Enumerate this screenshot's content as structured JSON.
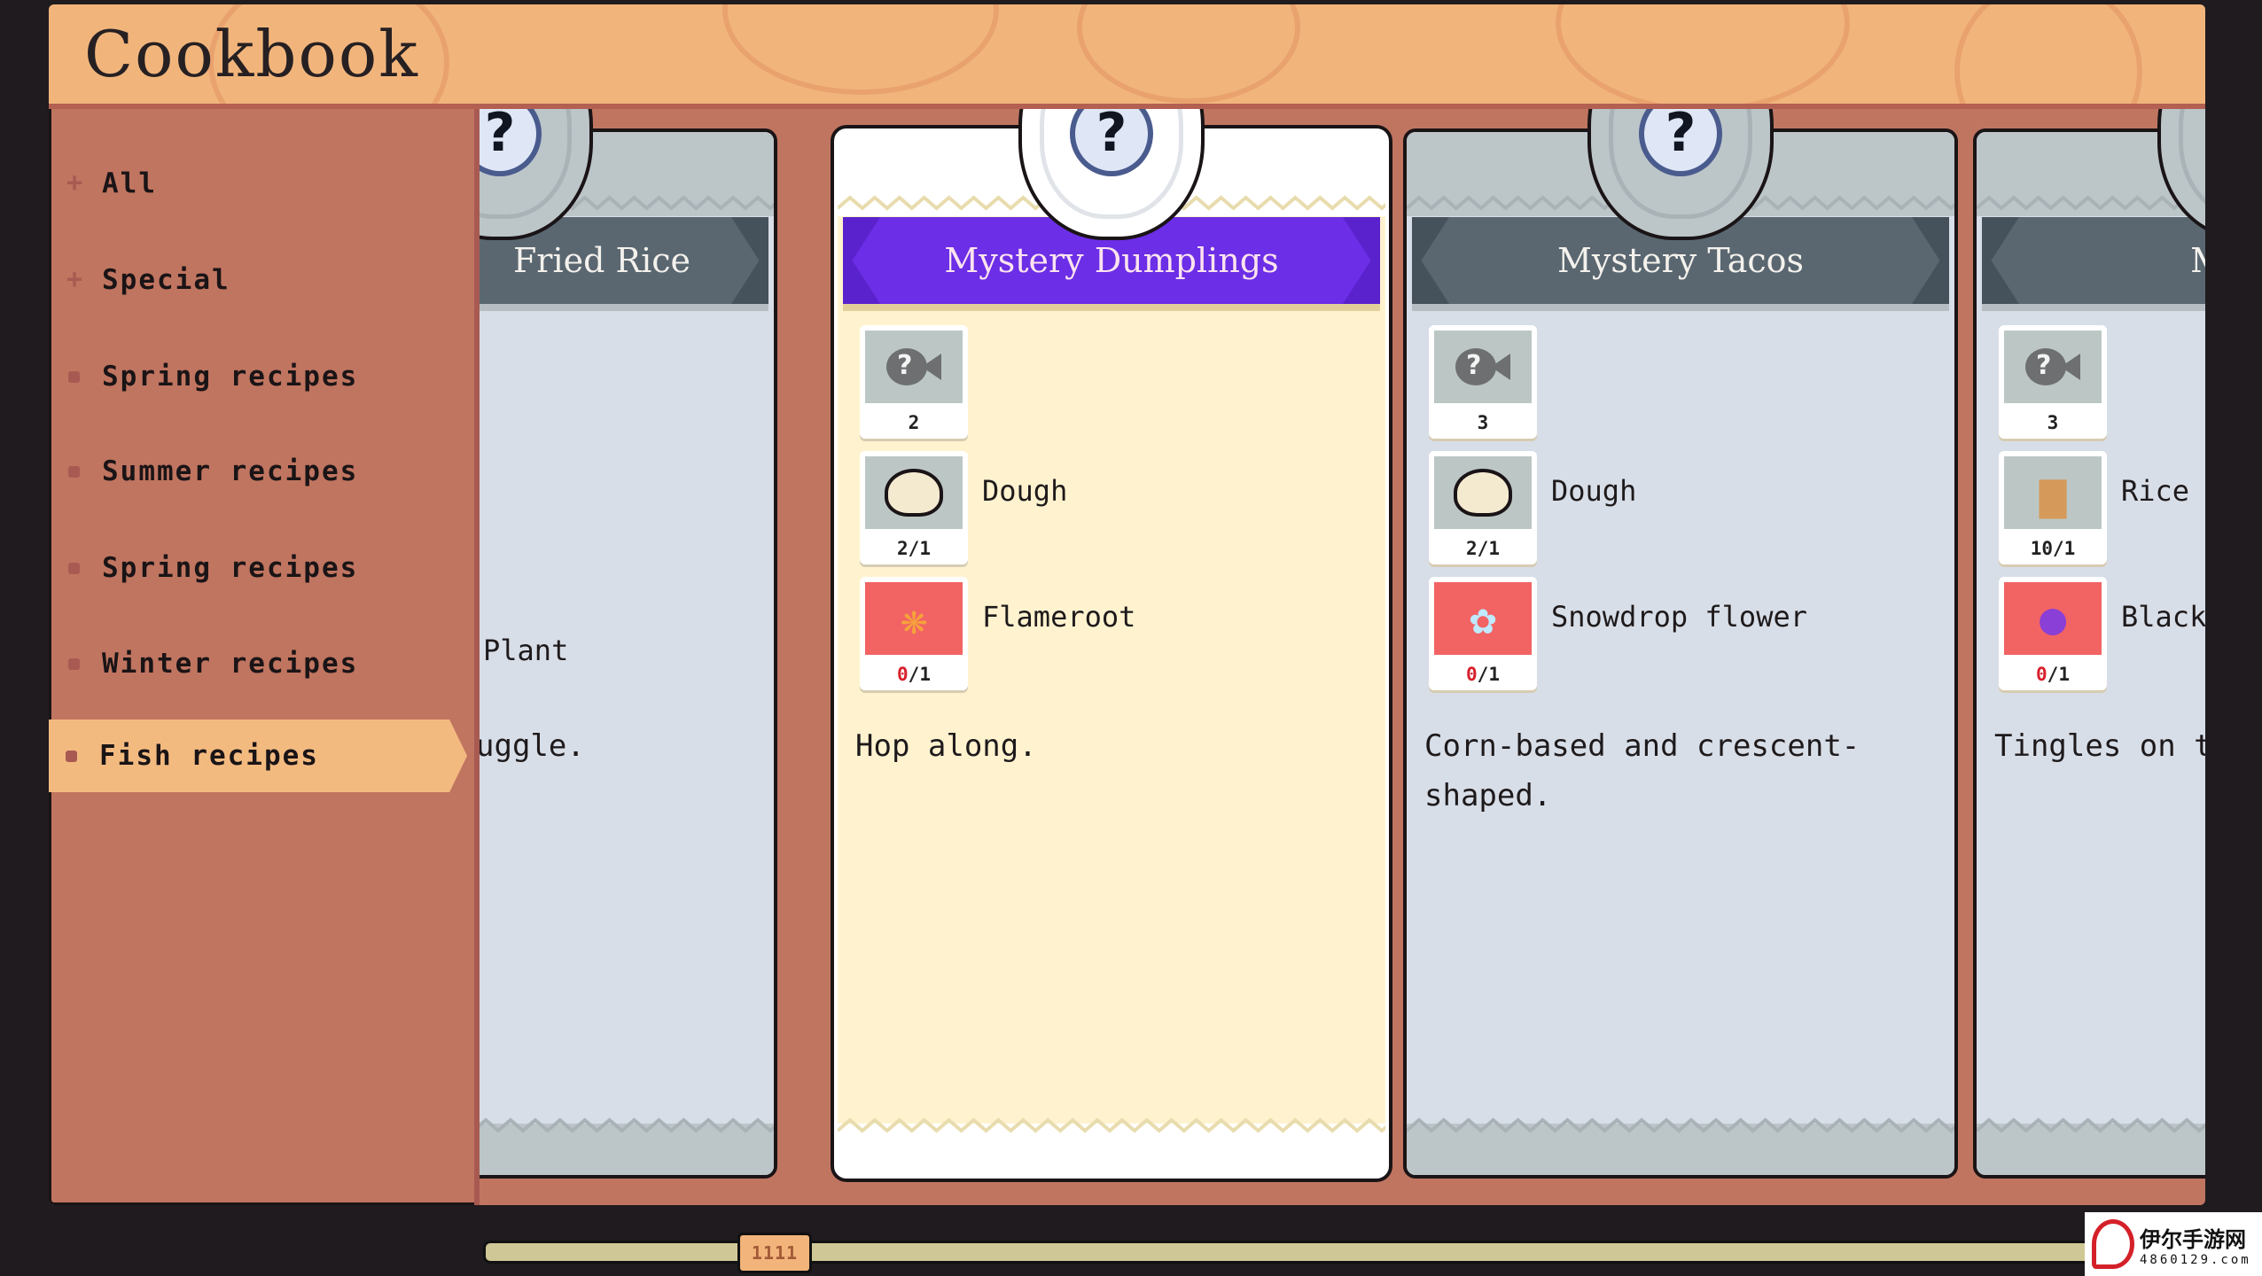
{
  "title": "Cookbook",
  "sidebar": {
    "items": [
      {
        "label": "All",
        "marker": "plus",
        "active": false
      },
      {
        "label": "Special",
        "marker": "plus",
        "active": false
      },
      {
        "label": "Spring recipes",
        "marker": "dot",
        "active": false
      },
      {
        "label": "Summer recipes",
        "marker": "dot",
        "active": false
      },
      {
        "label": "Spring recipes",
        "marker": "dot",
        "active": false
      },
      {
        "label": "Winter recipes",
        "marker": "dot",
        "active": false
      },
      {
        "label": "Fish recipes",
        "marker": "dot",
        "active": true
      }
    ]
  },
  "cards": [
    {
      "name": "Fried Rice",
      "visible_name": "Fried Rice",
      "selected": false,
      "partial": "left",
      "ingredients": [
        {
          "name": "Plant",
          "visible_name": "Plant",
          "qty": ""
        }
      ],
      "description": "uggle."
    },
    {
      "name": "Mystery Dumplings",
      "selected": true,
      "ingredients": [
        {
          "icon": "mystery-fish-icon",
          "name": "",
          "qty_have": "2",
          "qty_need": "",
          "missing": false
        },
        {
          "icon": "dough-icon",
          "name": "Dough",
          "qty_have": "2",
          "qty_need": "1",
          "missing": false
        },
        {
          "icon": "flameroot-icon",
          "name": "Flameroot",
          "qty_have": "0",
          "qty_need": "1",
          "missing": true
        }
      ],
      "description": "Hop along."
    },
    {
      "name": "Mystery Tacos",
      "selected": false,
      "ingredients": [
        {
          "icon": "mystery-fish-icon",
          "name": "",
          "qty_have": "3",
          "qty_need": "",
          "missing": false
        },
        {
          "icon": "dough-icon",
          "name": "Dough",
          "qty_have": "2",
          "qty_need": "1",
          "missing": false
        },
        {
          "icon": "snowdrop-flower-icon",
          "name": "Snowdrop flower",
          "qty_have": "0",
          "qty_need": "1",
          "missing": true
        }
      ],
      "description": "Corn-based and crescent-shaped."
    },
    {
      "name": "Myster",
      "selected": false,
      "partial": "right",
      "ingredients": [
        {
          "icon": "mystery-fish-icon",
          "name": "",
          "qty_have": "3",
          "qty_need": "",
          "missing": false
        },
        {
          "icon": "rice-icon",
          "name": "Rice",
          "qty_have": "10",
          "qty_need": "1",
          "missing": false
        },
        {
          "icon": "berries-icon",
          "name": "Black P",
          "qty_have": "0",
          "qty_need": "1",
          "missing": true
        }
      ],
      "description": "Tingles on the"
    }
  ],
  "scrollbar": {
    "thumb_grip": "1111",
    "position_fraction": 0.16
  },
  "watermark": {
    "name": "伊尔手游网",
    "url": "4860129.com"
  },
  "colors": {
    "background": "#1f1b1e",
    "header": "#f1b57c",
    "sidebar": "#c07560",
    "selected_banner": "#6c2ee6",
    "banner": "#5a6771",
    "missing": "#f26363",
    "selected_card": "#fff3cf",
    "card": "#d8dee7"
  }
}
